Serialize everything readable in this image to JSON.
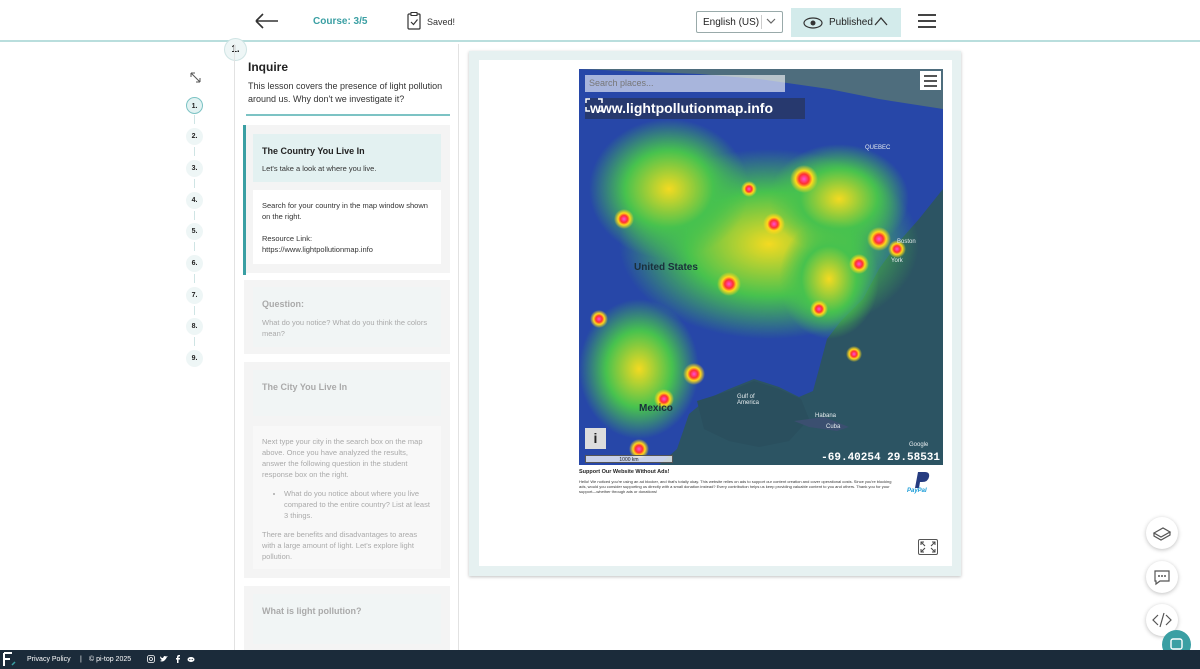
{
  "header": {
    "course_label": "Course: 3/5",
    "saved_label": "Saved!",
    "language": "English (US)",
    "published_label": "Published"
  },
  "nav": {
    "current_step": "1.",
    "steps": [
      "1.",
      "2.",
      "3.",
      "4.",
      "5.",
      "6.",
      "7.",
      "8.",
      "9."
    ]
  },
  "lesson": {
    "title": "Inquire",
    "intro": "This lesson covers the presence of light pollution around us. Why don't we investigate it?",
    "cards": [
      {
        "heading": "The Country You Live In",
        "subheading": "Let's take a look at where you live.",
        "body": "Search for your country in the map window shown on the right.",
        "resource_label": "Resource Link:",
        "resource_url": "https://www.lightpollutionmap.info"
      },
      {
        "heading": "Question:",
        "body": "What do you notice? What do you think the colors mean?"
      },
      {
        "heading": "The City You Live In",
        "body": "Next type your city in the search box on the map above. Once you have analyzed the results, answer the following question in the student response box on the right.",
        "bullet": "What do you notice about where you live compared to the entire country? List at least 3 things.",
        "body2": "There are benefits and disadvantages to areas with a large amount of light. Let's explore light pollution."
      },
      {
        "heading": "What is light pollution?"
      }
    ]
  },
  "map": {
    "search_placeholder": "Search places...",
    "site": "www.lightpollutionmap.info",
    "info_btn": "i",
    "scale": "1000 km",
    "coords": "-69.40254 29.58531",
    "labels": {
      "us": "United States",
      "mexico": "Mexico",
      "quebec": "QUEBEC",
      "boston": "Boston",
      "york": "York",
      "gulf": "Gulf of America",
      "havana": "Habana",
      "cuba": "Cuba",
      "google": "Google"
    },
    "ad_heading": "Support Our Website Without Ads!",
    "ad_text": "Hello! We noticed you're using an ad blocker, and that's totally okay. This website relies on ads to support our content creation and cover operational costs. Since you're blocking ads, would you consider supporting us directly with a small donation instead? Every contribution helps us keep providing valuable content to you and others. Thank you for your support—whether through ads or donations!",
    "paypal": "PayPal"
  },
  "footer": {
    "privacy": "Privacy Policy",
    "separator": "|",
    "copyright": "© pi-top 2025"
  },
  "colors": {
    "accent": "#3a9fa3",
    "published_bg": "#d3ebeb",
    "footer_bg": "#1b2b3a"
  }
}
